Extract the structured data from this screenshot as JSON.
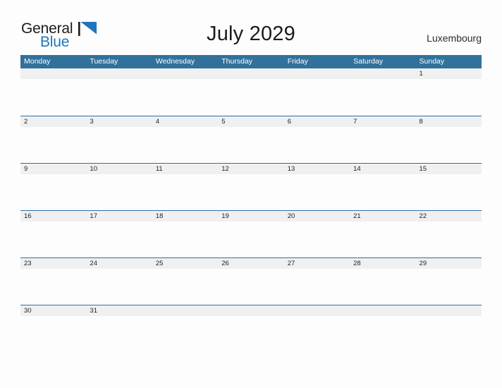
{
  "brand": {
    "name_part1": "General",
    "name_part2": "Blue",
    "flag_icon": "flag-triangle-icon",
    "color_dark": "#1b1b1b",
    "color_blue": "#1f76bc"
  },
  "header": {
    "month_title": "July 2029",
    "location": "Luxembourg"
  },
  "theme": {
    "header_blue": "#31719b",
    "rule_blue": "#2c6fa8",
    "band_gray": "#f0f0f0",
    "page_background": "#fdfdfd",
    "text_dark": "#222222"
  },
  "weekdays": [
    {
      "label": "Monday"
    },
    {
      "label": "Tuesday"
    },
    {
      "label": "Wednesday"
    },
    {
      "label": "Thursday"
    },
    {
      "label": "Friday"
    },
    {
      "label": "Saturday"
    },
    {
      "label": "Sunday"
    }
  ],
  "weeks": [
    {
      "days": [
        "",
        "",
        "",
        "",
        "",
        "",
        "1"
      ]
    },
    {
      "days": [
        "2",
        "3",
        "4",
        "5",
        "6",
        "7",
        "8"
      ]
    },
    {
      "days": [
        "9",
        "10",
        "11",
        "12",
        "13",
        "14",
        "15"
      ]
    },
    {
      "days": [
        "16",
        "17",
        "18",
        "19",
        "20",
        "21",
        "22"
      ]
    },
    {
      "days": [
        "23",
        "24",
        "25",
        "26",
        "27",
        "28",
        "29"
      ]
    },
    {
      "days": [
        "30",
        "31",
        "",
        "",
        "",
        "",
        ""
      ]
    }
  ]
}
